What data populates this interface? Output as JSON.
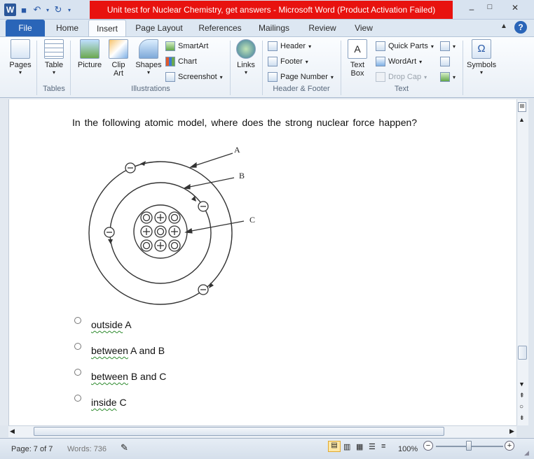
{
  "window": {
    "title": "Unit test for Nuclear Chemistry, get answers  -  Microsoft Word (Product Activation Failed)",
    "app_logo": "W"
  },
  "tabs": [
    {
      "label": "File"
    },
    {
      "label": "Home"
    },
    {
      "label": "Insert"
    },
    {
      "label": "Page Layout"
    },
    {
      "label": "References"
    },
    {
      "label": "Mailings"
    },
    {
      "label": "Review"
    },
    {
      "label": "View"
    }
  ],
  "ribbon": {
    "pages": "Pages",
    "table": "Table",
    "picture": "Picture",
    "clip_art": "Clip Art",
    "shapes": "Shapes",
    "smartart": "SmartArt",
    "chart": "Chart",
    "screenshot": "Screenshot",
    "links": "Links",
    "header": "Header",
    "footer": "Footer",
    "page_number": "Page Number",
    "text_box": "Text Box",
    "quick_parts": "Quick Parts",
    "wordart": "WordArt",
    "drop_cap": "Drop Cap",
    "symbols": "Symbols",
    "groups": {
      "tables": "Tables",
      "illustrations": "Illustrations",
      "header_footer": "Header & Footer",
      "text": "Text"
    }
  },
  "document": {
    "question": "In the following atomic model, where does the strong nuclear force happen?",
    "diagram_labels": {
      "a": "A",
      "b": "B",
      "c": "C"
    },
    "options": [
      {
        "word": "outside",
        "rest": " A"
      },
      {
        "word": "between",
        "rest": " A and B"
      },
      {
        "word": "between",
        "rest": " B and C"
      },
      {
        "word": "inside",
        "rest": " C"
      }
    ]
  },
  "status": {
    "page": "Page: 7 of 7",
    "words": "Words: 736",
    "zoom": "100%"
  },
  "colors": {
    "title_bar_red": "#e8120f",
    "file_tab": "#2a65b8"
  }
}
